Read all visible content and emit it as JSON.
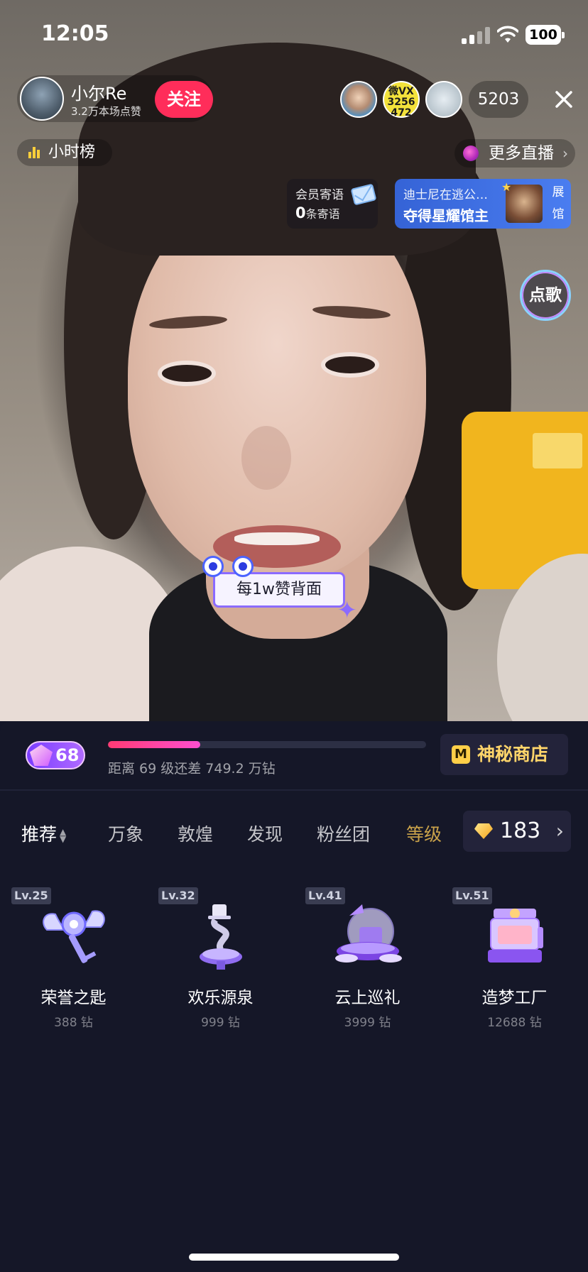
{
  "status_bar": {
    "time": "12:05",
    "battery": "100"
  },
  "streamer": {
    "name": "小尔Re",
    "likes_text": "3.2万本场点赞",
    "follow_label": "关注"
  },
  "viewers": {
    "badge_lines": [
      "微VX",
      "3256",
      "472"
    ],
    "count": "5203"
  },
  "hour_rank_label": "小时榜",
  "more_live_label": "更多直播",
  "member_message": {
    "title": "会员寄语",
    "count": "0",
    "suffix": "条寄语"
  },
  "exhibit": {
    "line1": "迪士尼在逃公…",
    "line2": "夺得星耀馆主",
    "side": [
      "展",
      "馆"
    ]
  },
  "sing_label": "点歌",
  "sticker_text": "每1w赞背面",
  "gift_panel": {
    "level": "68",
    "level_progress": 0.29,
    "level_note": "距离 69 级还差 749.2 万钻",
    "shop_label": "神秘商店",
    "shop_icon": "M",
    "tabs": [
      {
        "label": "推荐",
        "state": "active"
      },
      {
        "label": "万象",
        "state": "normal"
      },
      {
        "label": "敦煌",
        "state": "normal"
      },
      {
        "label": "发现",
        "state": "normal"
      },
      {
        "label": "粉丝团",
        "state": "normal"
      },
      {
        "label": "等级",
        "state": "gold"
      }
    ],
    "balance": "183",
    "gifts": [
      {
        "level": "Lv.25",
        "name": "荣誉之匙",
        "price": "388 钻",
        "icon": "winged-key-icon"
      },
      {
        "level": "Lv.32",
        "name": "欢乐源泉",
        "price": "999 钻",
        "icon": "fountain-icon"
      },
      {
        "level": "Lv.41",
        "name": "云上巡礼",
        "price": "3999 钻",
        "icon": "airship-icon"
      },
      {
        "level": "Lv.51",
        "name": "造梦工厂",
        "price": "12688 钻",
        "icon": "dream-factory-icon"
      }
    ]
  },
  "colors": {
    "follow": "#ff2d5a",
    "shop_text": "#ffd56a",
    "progress": "#ff3b74",
    "panel_bg": "#151728"
  }
}
